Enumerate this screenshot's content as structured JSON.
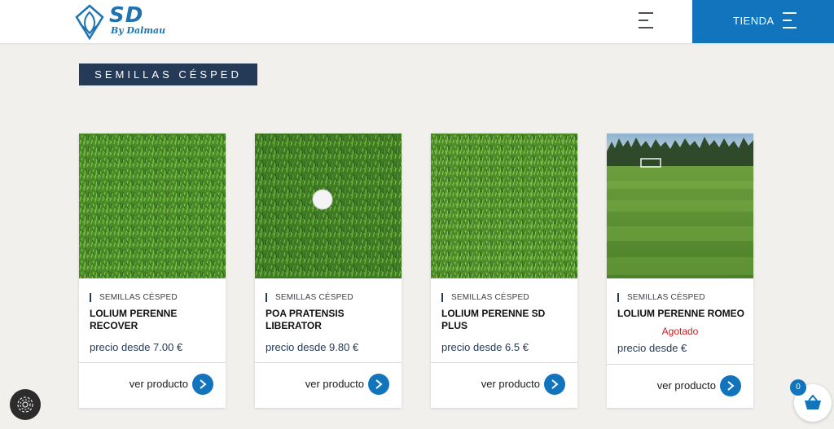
{
  "header": {
    "logo_text": "SD",
    "logo_sub": "By Dalmau",
    "tienda_label": "TIENDA"
  },
  "category": {
    "label": "SEMILLAS CÉSPED"
  },
  "products": [
    {
      "category": "SEMILLAS CÉSPED",
      "title": "LOLIUM PERENNE RECOVER",
      "status": "",
      "price": "precio desde 7.00 €",
      "link_label": "ver producto",
      "image": "grass-closeup"
    },
    {
      "category": "SEMILLAS CÉSPED",
      "title": "POA PRATENSIS LIBERATOR",
      "status": "",
      "price": "precio desde 9.80 €",
      "link_label": "ver producto",
      "image": "grass-golf-ball"
    },
    {
      "category": "SEMILLAS CÉSPED",
      "title": "LOLIUM PERENNE SD PLUS",
      "status": "",
      "price": "precio desde 6.5 €",
      "link_label": "ver producto",
      "image": "grass-closeup"
    },
    {
      "category": "SEMILLAS CÉSPED",
      "title": "LOLIUM PERENNE ROMEO",
      "status": "Agotado",
      "price": "precio desde €",
      "link_label": "ver producto",
      "image": "football-field"
    }
  ],
  "cart": {
    "count": "0",
    "icon": "basket-icon"
  },
  "colors": {
    "brand_blue": "#1174bc",
    "badge_navy": "#253a56",
    "sold_out_red": "#d11b1b"
  }
}
